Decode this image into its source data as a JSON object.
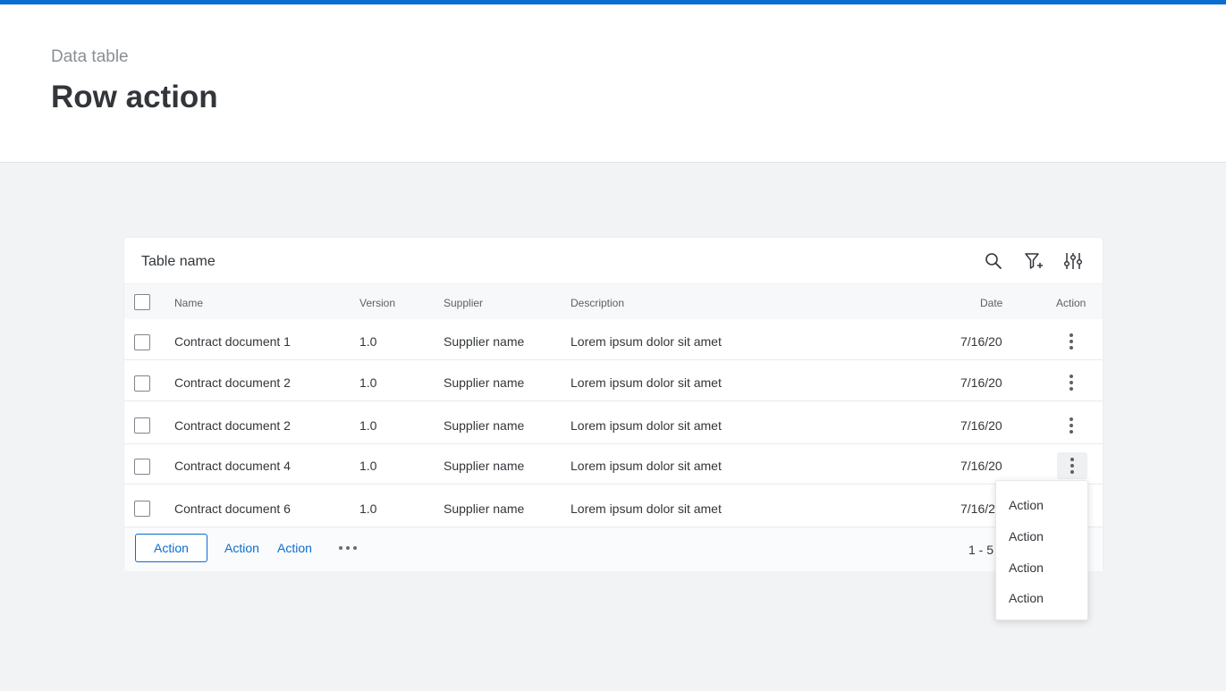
{
  "header": {
    "subtitle": "Data table",
    "title": "Row action"
  },
  "table": {
    "name": "Table name",
    "tools": [
      {
        "icon": "search-icon"
      },
      {
        "icon": "filter-add-icon"
      },
      {
        "icon": "settings-sliders-icon"
      }
    ],
    "columns": [
      "Name",
      "Version",
      "Supplier",
      "Description",
      "Date",
      "Action"
    ],
    "rows": [
      {
        "name": "Contract document 1",
        "version": "1.0",
        "supplier": "Supplier name",
        "description": "Lorem ipsum dolor sit amet",
        "date": "7/16/20"
      },
      {
        "name": "Contract document 2",
        "version": "1.0",
        "supplier": "Supplier name",
        "description": "Lorem ipsum dolor sit amet",
        "date": "7/16/20"
      },
      {
        "name": "Contract document 2",
        "version": "1.0",
        "supplier": "Supplier name",
        "description": "Lorem ipsum dolor sit amet",
        "date": "7/16/20"
      },
      {
        "name": "Contract document 4",
        "version": "1.0",
        "supplier": "Supplier name",
        "description": "Lorem ipsum dolor sit amet",
        "date": "7/16/20"
      },
      {
        "name": "Contract document 6",
        "version": "1.0",
        "supplier": "Supplier name",
        "description": "Lorem ipsum dolor sit amet",
        "date": "7/16/2"
      }
    ]
  },
  "footer": {
    "primary_action": "Action",
    "actions": [
      "Action",
      "Action"
    ],
    "more_icon": "more-horizontal-icon",
    "pagination": "1 - 5"
  },
  "row_menu": {
    "items": [
      "Action",
      "Action",
      "Action",
      "Action"
    ]
  },
  "colors": {
    "accent": "#0a6ed1",
    "background": "#f2f3f5",
    "text": "#32363a"
  }
}
